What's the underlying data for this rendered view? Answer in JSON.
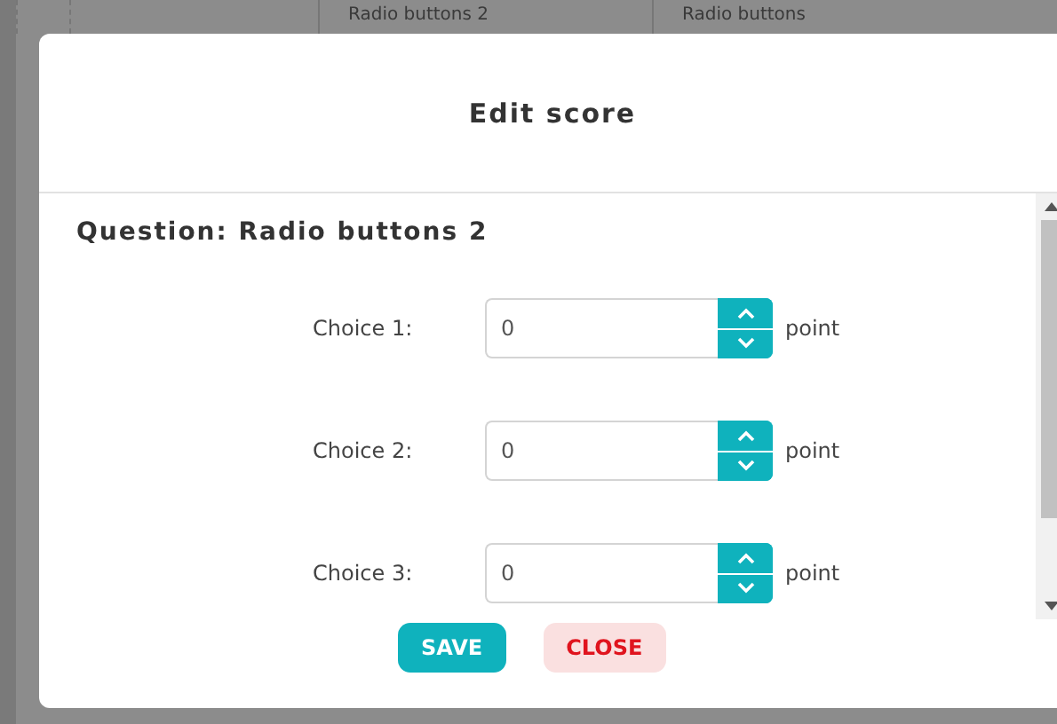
{
  "background_table": {
    "columns": [
      "Radio buttons 2",
      "Radio buttons"
    ]
  },
  "dialog": {
    "title": "Edit score",
    "question": "Question: Radio buttons 2",
    "choices": [
      {
        "label": "Choice 1:",
        "value": "0",
        "unit": "point"
      },
      {
        "label": "Choice 2:",
        "value": "0",
        "unit": "point"
      },
      {
        "label": "Choice 3:",
        "value": "0",
        "unit": "point"
      }
    ],
    "buttons": [
      {
        "label": "SAVE",
        "kind": "primary"
      },
      {
        "label": "CLOSE",
        "kind": "danger"
      }
    ]
  }
}
